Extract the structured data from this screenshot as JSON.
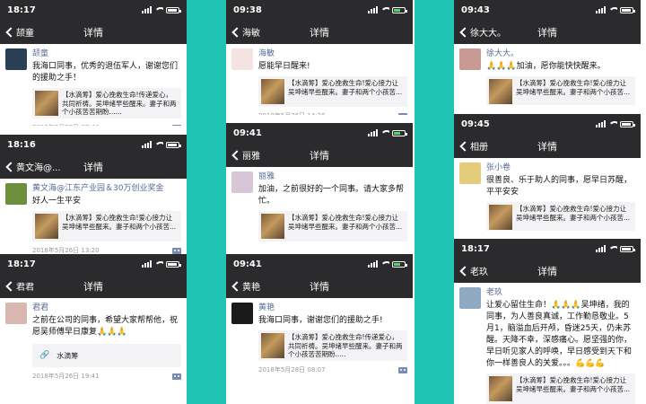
{
  "page": {
    "title": "详情"
  },
  "columns": [
    {
      "cards": [
        {
          "time": "18:17",
          "back": "颉童",
          "battery": "white",
          "name": "颉童",
          "text": "我海口同事，优秀的退伍军人，谢谢您们的援助之手！",
          "link_text": "【水滴筹】爱心挽救生命!传递爱心，共同祈祷。吴坤绪早些醒来。妻子和两个小孩苦苦期盼......",
          "timestamp": "2018年5月27日 07:40"
        },
        {
          "time": "18:16",
          "back": "黄文海@...",
          "battery": "white",
          "name": "黄文海@江东产业园＆30万创业奖金",
          "text": "好人一生平安",
          "link_text": "【水滴筹】爱心挽救生命!爱心接力让吴坤绪早些醒来。妻子和两个小孩苦...",
          "timestamp": "2018年5月26日 13:20"
        },
        {
          "time": "18:17",
          "back": "君君",
          "battery": "white",
          "name": "君君",
          "text": "之前在公司的同事，希望大家帮帮他，祝愿吴师傅早日康复🙏🙏🙏",
          "link_text": "水滴筹",
          "timestamp": "2018年5月26日 19:41"
        }
      ]
    },
    {
      "cards": [
        {
          "time": "09:38",
          "back": "海敏",
          "battery": "green",
          "name": "海敏",
          "text": "愿能早日醒来!",
          "link_text": "【水滴筹】爱心挽救生命!爱心接力让吴坤绪早些醒来。妻子和两个小孩苦...",
          "timestamp": "2018年5月26日 14:26"
        },
        {
          "time": "09:41",
          "back": "丽雅",
          "battery": "green",
          "name": "丽雅",
          "text": "加油，之前很好的一个同事。请大家多帮忙。",
          "link_text": "【水滴筹】爱心挽救生命!爱心接力让吴坤绪早些醒来。妻子和两个小孩苦...",
          "timestamp": "2018年5月26日 15:21"
        },
        {
          "time": "09:41",
          "back": "黄艳",
          "battery": "green",
          "name": "黄艳",
          "text": "我海口同事，谢谢您们的援助之手!",
          "link_text": "【水滴筹】爱心挽救生命!传递爱心，共同祈祷。吴坤绪早些醒来。妻子和两个小孩苦苦期盼.....",
          "timestamp": "2018年5月28日 08:07"
        }
      ]
    },
    {
      "cards": [
        {
          "time": "09:43",
          "back": "徐大大。",
          "battery": "white",
          "name": "徐大大。",
          "text": "🙏🙏🙏加油，愿你能快快醒来。",
          "link_text": "【水滴筹】爱心挽救生命!爱心接力让吴坤绪早些醒来。妻子和两个小孩苦...",
          "timestamp": "2018年5月26日 13:31"
        },
        {
          "time": "09:45",
          "back": "相册",
          "battery": "white",
          "name": "张小卷",
          "text": "很善良、乐于助人的同事，愿早日苏醒，平平安安",
          "link_text": "【水滴筹】爱心挽救生命!爱心接力让吴坤绪早些醒来。妻子和两个小孩苦...",
          "timestamp": "2018年6月26日 14:59",
          "delete": "删除"
        },
        {
          "time": "18:17",
          "back": "老玖",
          "battery": "white",
          "name": "老玖",
          "text": "让爱心留住生命！🙏🙏🙏吴坤绪，我的同事，为人善良真诚，工作勤恳敬业。5月1，脑溢血后开颅，昏迷25天，仍未苏醒。天降不幸，深感痛心。愿坚强的你，早日听见家人的呼唤，早日感受到天下和你一样善良人的关爱。。。💪💪💪",
          "link_text": "【水滴筹】爱心挽救生命!爱心接力让吴坤绪早些醒来。妻子和两个小孩苦...",
          "timestamp": "2018年5月26日 16:25"
        }
      ]
    }
  ]
}
